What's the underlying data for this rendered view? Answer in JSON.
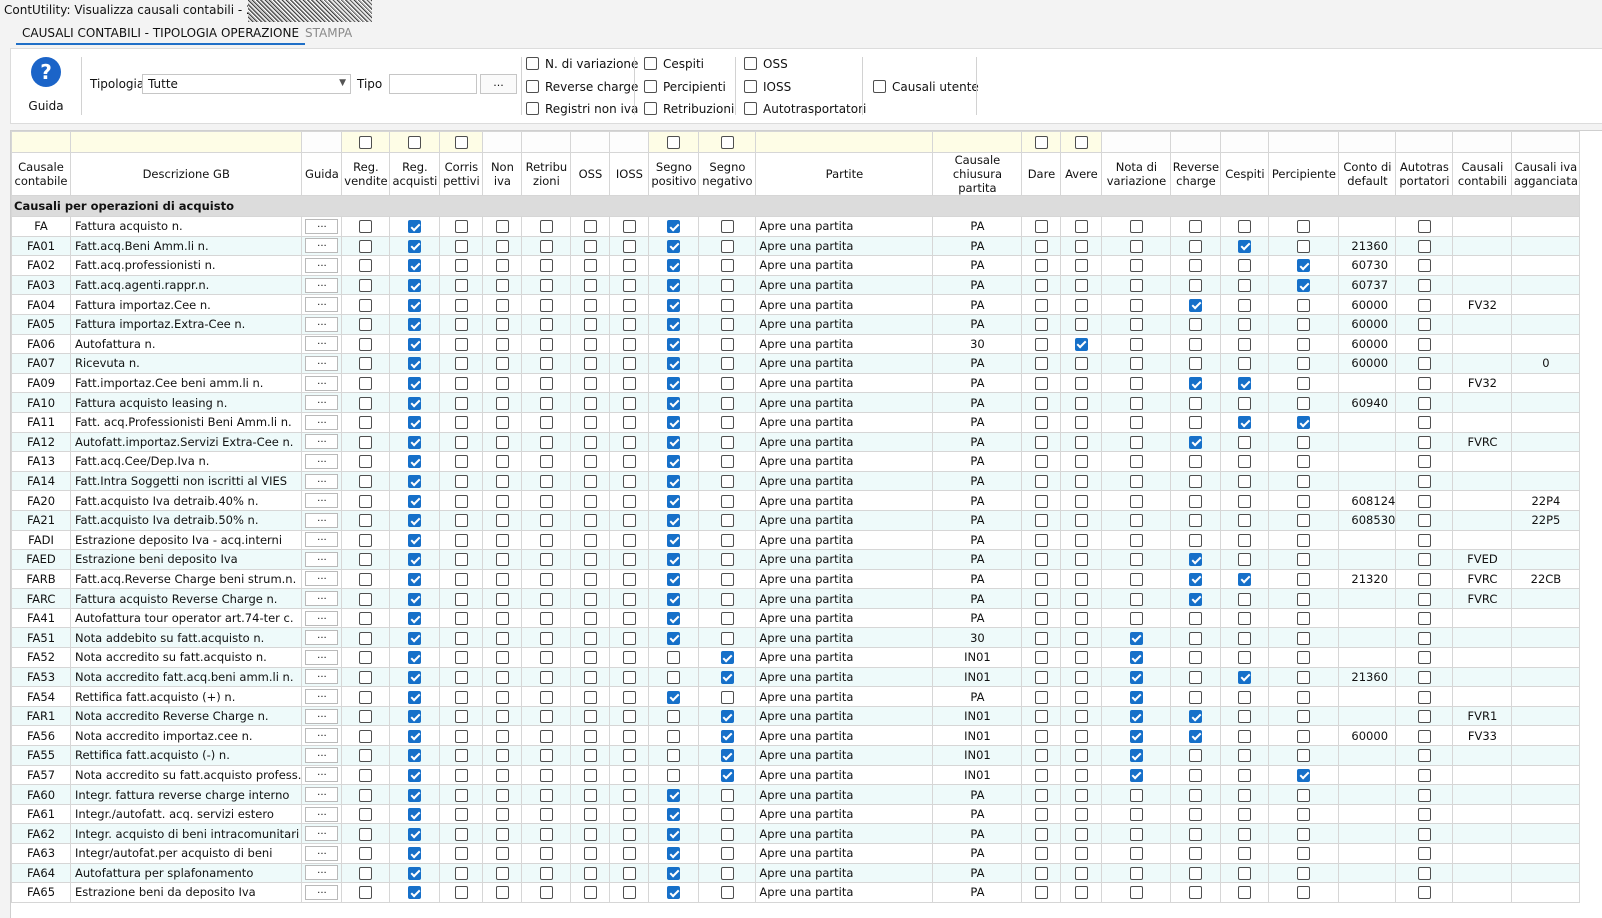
{
  "window": {
    "title": "ContUtility: Visualizza causali contabili - 2024 -"
  },
  "tabs": [
    {
      "label": "CAUSALI CONTABILI - TIPOLOGIA OPERAZIONE"
    },
    {
      "label": "STAMPA"
    }
  ],
  "toolbar": {
    "help_label": "Guida",
    "help_icon": "question-circle-icon",
    "tipologia_label": "Tipologia",
    "tipologia_value": "Tutte",
    "tipo_label": "Tipo",
    "tipo_value": "",
    "browse_label": "...",
    "filters": [
      {
        "label": "N. di variazione",
        "checked": false
      },
      {
        "label": "Reverse charge",
        "checked": false
      },
      {
        "label": "Registri non iva",
        "checked": false
      },
      {
        "label": "Cespiti",
        "checked": false
      },
      {
        "label": "Percipienti",
        "checked": false
      },
      {
        "label": "Retribuzioni",
        "checked": false
      },
      {
        "label": "OSS",
        "checked": false
      },
      {
        "label": "IOSS",
        "checked": false
      },
      {
        "label": "Autotrasportatori",
        "checked": false
      },
      {
        "label": "Causali utente",
        "checked": false
      }
    ]
  },
  "table": {
    "columns": [
      "Causale contabile",
      "Descrizione GB",
      "Guida",
      "Reg. vendite",
      "Reg. acquisti",
      "Corris pettivi",
      "Non iva",
      "Retribu zioni",
      "OSS",
      "IOSS",
      "Segno positivo",
      "Segno negativo",
      "Partite",
      "Causale chiusura partita",
      "Dare",
      "Avere",
      "Nota di variazione",
      "Reverse charge",
      "Cespiti",
      "Percipiente",
      "Conto di default",
      "Autotras portatori",
      "Causali contabili",
      "Causali iva agganciata"
    ],
    "section_title": "Causali per operazioni di acquisto",
    "guida_button": "...",
    "rows": [
      {
        "code": "FA",
        "desc": "Fattura acquisto n.",
        "chk": "0100000100",
        "partita": "Apre una partita",
        "chiusura": "PA",
        "chk2": "000000",
        "conto": "",
        "cc": "",
        "ci": ""
      },
      {
        "code": "FA01",
        "desc": "Fatt.acq.Beni Amm.li n.",
        "chk": "0100000100",
        "partita": "Apre una partita",
        "chiusura": "PA",
        "chk2": "000010",
        "conto": "21360",
        "cc": "",
        "ci": ""
      },
      {
        "code": "FA02",
        "desc": "Fatt.acq.professionisti n.",
        "chk": "0100000100",
        "partita": "Apre una partita",
        "chiusura": "PA",
        "chk2": "000001",
        "conto": "60730",
        "cc": "",
        "ci": ""
      },
      {
        "code": "FA03",
        "desc": "Fatt.acq.agenti.rappr.n.",
        "chk": "0100000100",
        "partita": "Apre una partita",
        "chiusura": "PA",
        "chk2": "000001",
        "conto": "60737",
        "cc": "",
        "ci": ""
      },
      {
        "code": "FA04",
        "desc": "Fattura importaz.Cee n.",
        "chk": "0100000100",
        "partita": "Apre una partita",
        "chiusura": "PA",
        "chk2": "000100",
        "conto": "60000",
        "cc": "FV32",
        "ci": ""
      },
      {
        "code": "FA05",
        "desc": "Fattura importaz.Extra-Cee n.",
        "chk": "0100000100",
        "partita": "Apre una partita",
        "chiusura": "PA",
        "chk2": "000000",
        "conto": "60000",
        "cc": "",
        "ci": ""
      },
      {
        "code": "FA06",
        "desc": "Autofattura n.",
        "chk": "0100000100",
        "partita": "Apre una partita",
        "chiusura": "30",
        "chk2": "010000",
        "conto": "60000",
        "cc": "",
        "ci": ""
      },
      {
        "code": "FA07",
        "desc": "Ricevuta n.",
        "chk": "0100000100",
        "partita": "Apre una partita",
        "chiusura": "PA",
        "chk2": "000000",
        "conto": "60000",
        "cc": "",
        "ci": "0"
      },
      {
        "code": "FA09",
        "desc": "Fatt.importaz.Cee beni amm.li n.",
        "chk": "0100000100",
        "partita": "Apre una partita",
        "chiusura": "PA",
        "chk2": "000110",
        "conto": "",
        "cc": "FV32",
        "ci": ""
      },
      {
        "code": "FA10",
        "desc": "Fattura acquisto leasing n.",
        "chk": "0100000100",
        "partita": "Apre una partita",
        "chiusura": "PA",
        "chk2": "000000",
        "conto": "60940",
        "cc": "",
        "ci": ""
      },
      {
        "code": "FA11",
        "desc": "Fatt. acq.Professionisti Beni Amm.li n.",
        "chk": "0100000100",
        "partita": "Apre una partita",
        "chiusura": "PA",
        "chk2": "000011",
        "conto": "",
        "cc": "",
        "ci": ""
      },
      {
        "code": "FA12",
        "desc": "Autofatt.importaz.Servizi Extra-Cee n.",
        "chk": "0100000100",
        "partita": "Apre una partita",
        "chiusura": "PA",
        "chk2": "000100",
        "conto": "",
        "cc": "FVRC",
        "ci": ""
      },
      {
        "code": "FA13",
        "desc": "Fatt.acq.Cee/Dep.Iva n.",
        "chk": "0100000100",
        "partita": "Apre una partita",
        "chiusura": "PA",
        "chk2": "000000",
        "conto": "",
        "cc": "",
        "ci": ""
      },
      {
        "code": "FA14",
        "desc": "Fatt.Intra Soggetti non iscritti al VIES",
        "chk": "0100000100",
        "partita": "Apre una partita",
        "chiusura": "PA",
        "chk2": "000000",
        "conto": "",
        "cc": "",
        "ci": ""
      },
      {
        "code": "FA20",
        "desc": "Fatt.acquisto Iva detraib.40% n.",
        "chk": "0100000100",
        "partita": "Apre una partita",
        "chiusura": "PA",
        "chk2": "000000",
        "conto": "608124",
        "cc": "",
        "ci": "22P4"
      },
      {
        "code": "FA21",
        "desc": "Fatt.acquisto Iva detraib.50% n.",
        "chk": "0100000100",
        "partita": "Apre una partita",
        "chiusura": "PA",
        "chk2": "000000",
        "conto": "608530",
        "cc": "",
        "ci": "22P5"
      },
      {
        "code": "FADI",
        "desc": "Estrazione deposito Iva - acq.interni",
        "chk": "0100000100",
        "partita": "Apre una partita",
        "chiusura": "PA",
        "chk2": "000000",
        "conto": "",
        "cc": "",
        "ci": ""
      },
      {
        "code": "FAED",
        "desc": "Estrazione beni deposito Iva",
        "chk": "0100000100",
        "partita": "Apre una partita",
        "chiusura": "PA",
        "chk2": "000100",
        "conto": "",
        "cc": "FVED",
        "ci": ""
      },
      {
        "code": "FARB",
        "desc": "Fatt.acq.Reverse Charge beni strum.n.",
        "chk": "0100000100",
        "partita": "Apre una partita",
        "chiusura": "PA",
        "chk2": "000110",
        "conto": "21320",
        "cc": "FVRC",
        "ci": "22CB"
      },
      {
        "code": "FARC",
        "desc": "Fattura acquisto Reverse Charge n.",
        "chk": "0100000100",
        "partita": "Apre una partita",
        "chiusura": "PA",
        "chk2": "000100",
        "conto": "",
        "cc": "FVRC",
        "ci": ""
      },
      {
        "code": "FA41",
        "desc": "Autofattura tour operator art.74-ter c.",
        "chk": "0100000100",
        "partita": "Apre una partita",
        "chiusura": "PA",
        "chk2": "000000",
        "conto": "",
        "cc": "",
        "ci": ""
      },
      {
        "code": "FA51",
        "desc": "Nota addebito su fatt.acquisto n.",
        "chk": "0100000100",
        "partita": "Apre una partita",
        "chiusura": "30",
        "chk2": "001000",
        "conto": "",
        "cc": "",
        "ci": ""
      },
      {
        "code": "FA52",
        "desc": "Nota accredito su fatt.acquisto n.",
        "chk": "0100000010",
        "partita": "Apre una partita",
        "chiusura": "IN01",
        "chk2": "001000",
        "conto": "",
        "cc": "",
        "ci": ""
      },
      {
        "code": "FA53",
        "desc": "Nota accredito fatt.acq.beni amm.li n.",
        "chk": "0100000010",
        "partita": "Apre una partita",
        "chiusura": "IN01",
        "chk2": "001010",
        "conto": "21360",
        "cc": "",
        "ci": ""
      },
      {
        "code": "FA54",
        "desc": "Rettifica fatt.acquisto (+) n.",
        "chk": "0100000100",
        "partita": "Apre una partita",
        "chiusura": "PA",
        "chk2": "001000",
        "conto": "",
        "cc": "",
        "ci": ""
      },
      {
        "code": "FAR1",
        "desc": "Nota accredito Reverse Charge n.",
        "chk": "0100000010",
        "partita": "Apre una partita",
        "chiusura": "IN01",
        "chk2": "001100",
        "conto": "",
        "cc": "FVR1",
        "ci": ""
      },
      {
        "code": "FA56",
        "desc": "Nota accredito importaz.cee n.",
        "chk": "0100000010",
        "partita": "Apre una partita",
        "chiusura": "IN01",
        "chk2": "001100",
        "conto": "60000",
        "cc": "FV33",
        "ci": ""
      },
      {
        "code": "FA55",
        "desc": "Rettifica fatt.acquisto (-) n.",
        "chk": "0100000010",
        "partita": "Apre una partita",
        "chiusura": "IN01",
        "chk2": "001000",
        "conto": "",
        "cc": "",
        "ci": ""
      },
      {
        "code": "FA57",
        "desc": "Nota accredito su fatt.acquisto profess.",
        "chk": "0100000010",
        "partita": "Apre una partita",
        "chiusura": "IN01",
        "chk2": "001001",
        "conto": "",
        "cc": "",
        "ci": ""
      },
      {
        "code": "FA60",
        "desc": "Integr. fattura reverse charge interno",
        "chk": "0100000100",
        "partita": "Apre una partita",
        "chiusura": "PA",
        "chk2": "000000",
        "conto": "",
        "cc": "",
        "ci": ""
      },
      {
        "code": "FA61",
        "desc": "Integr./autofatt. acq. servizi estero",
        "chk": "0100000100",
        "partita": "Apre una partita",
        "chiusura": "PA",
        "chk2": "000000",
        "conto": "",
        "cc": "",
        "ci": ""
      },
      {
        "code": "FA62",
        "desc": "Integr. acquisto di beni intracomunitari",
        "chk": "0100000100",
        "partita": "Apre una partita",
        "chiusura": "PA",
        "chk2": "000000",
        "conto": "",
        "cc": "",
        "ci": ""
      },
      {
        "code": "FA63",
        "desc": "Integr/autofat.per acquisto di beni",
        "chk": "0100000100",
        "partita": "Apre una partita",
        "chiusura": "PA",
        "chk2": "000000",
        "conto": "",
        "cc": "",
        "ci": ""
      },
      {
        "code": "FA64",
        "desc": "Autofattura per splafonamento",
        "chk": "0100000100",
        "partita": "Apre una partita",
        "chiusura": "PA",
        "chk2": "000000",
        "conto": "",
        "cc": "",
        "ci": ""
      },
      {
        "code": "FA65",
        "desc": "Estrazione beni da deposito Iva",
        "chk": "0100000100",
        "partita": "Apre una partita",
        "chiusura": "PA",
        "chk2": "000000",
        "conto": "",
        "cc": "",
        "ci": ""
      }
    ]
  },
  "colors": {
    "accent": "#1670c9",
    "row_alt": "#eefafa",
    "filter_row": "#fefde6",
    "section": "#dcdcdc"
  }
}
